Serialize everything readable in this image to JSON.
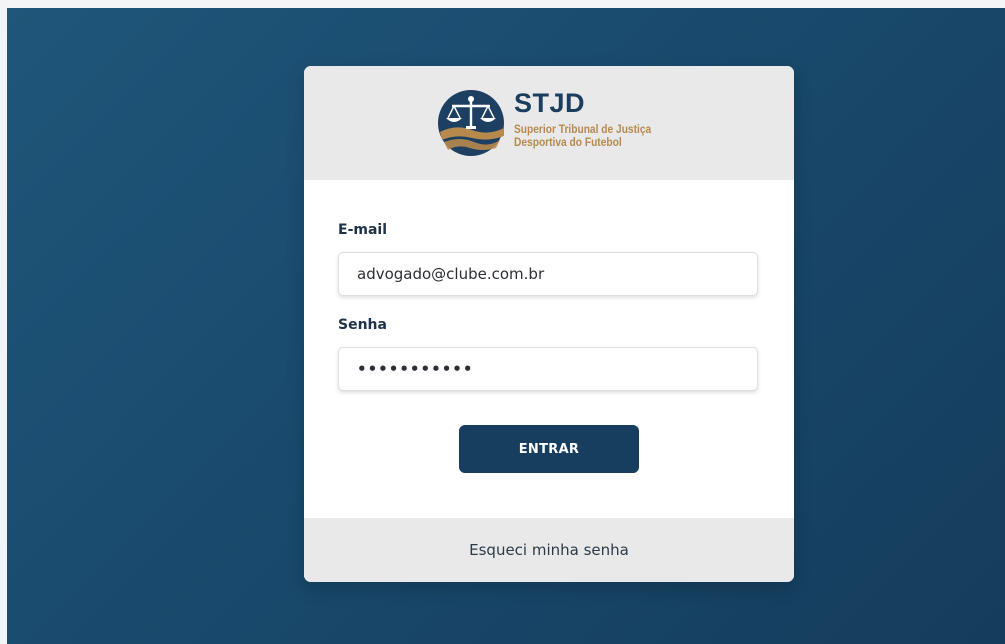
{
  "brand": {
    "acronym": "STJD",
    "subtitle_line1": "Superior Tribunal de Justiça",
    "subtitle_line2": "Desportiva do Futebol",
    "primary_color": "#183e5f",
    "accent_color": "#b7894d"
  },
  "form": {
    "email_label": "E-mail",
    "email_value": "advogado@clube.com.br",
    "password_label": "Senha",
    "password_value": "•••••••••••",
    "submit_label": "ENTRAR"
  },
  "footer": {
    "forgot_password": "Esqueci minha senha"
  }
}
